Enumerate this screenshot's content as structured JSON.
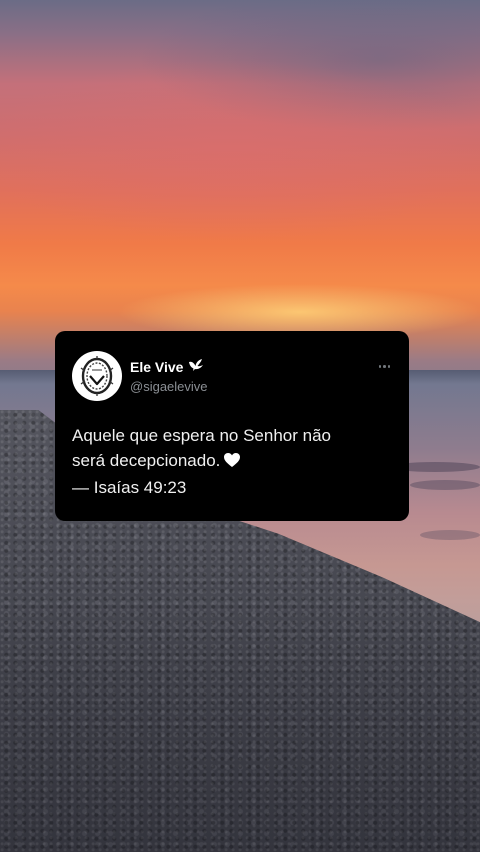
{
  "tweet": {
    "display_name": "Ele Vive",
    "handle": "@sigaelevive",
    "body_lines": [
      "Aquele que espera no Senhor não",
      "será decepcionado.",
      "— Isaías 49:23"
    ],
    "icons": {
      "avatar": "crown-of-thorns-avatar",
      "verified_badge": "dove-icon",
      "emoji": "white-heart-icon",
      "menu": "more-options-icon"
    }
  },
  "background": {
    "scene": "sunset beach with pebbles",
    "colors": {
      "sky_top": "#6b6c86",
      "sky_glow": "#f07a48",
      "sea": "#b88a90",
      "pebbles": "#4a4b54"
    }
  }
}
